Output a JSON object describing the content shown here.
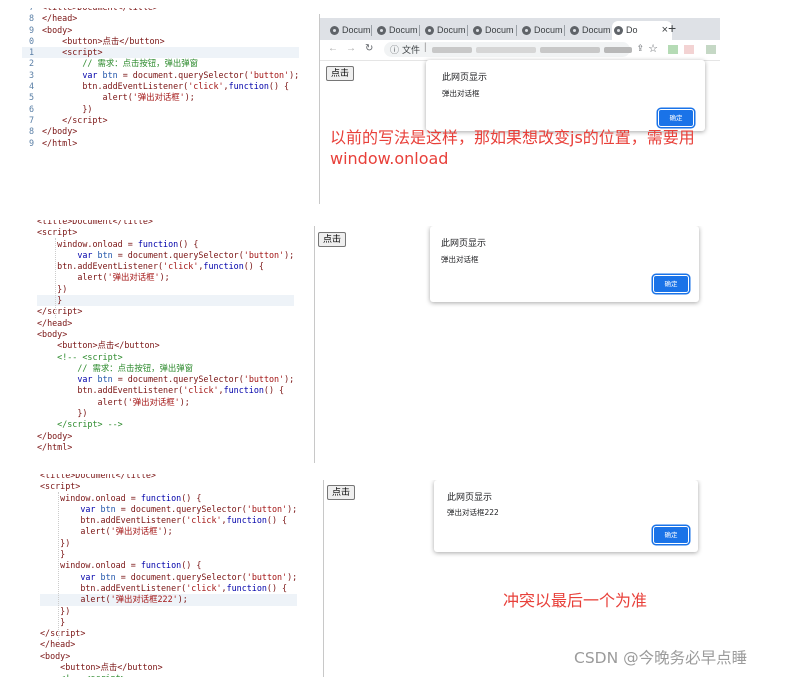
{
  "panel1": {
    "code_lines": [
      {
        "n": "",
        "html": "<span class=\"t\">&lt;title&gt;Document&lt;/title&gt;</span>"
      },
      {
        "n": "",
        "html": "<span class=\"t\">&lt;/head&gt;</span>"
      },
      {
        "n": "",
        "html": "<span class=\"t\">&lt;body&gt;</span>"
      },
      {
        "n": "",
        "html": "    <span class=\"t\">&lt;button&gt;</span>点击<span class=\"t\">&lt;/button&gt;</span>"
      },
      {
        "n": "",
        "html": "    <span class=\"t\">&lt;script&gt;</span>"
      },
      {
        "n": "",
        "html": "        <span class=\"c\">// 需求：点击按钮，弹出弹窗</span>"
      },
      {
        "n": "",
        "html": "        <span class=\"k\">var</span> <span class=\"v\">btn</span> = document.querySelector(<span class=\"s\">'button'</span>);"
      },
      {
        "n": "",
        "html": "        btn.addEventListener(<span class=\"s\">'click'</span>,<span class=\"k\">function</span>() {"
      },
      {
        "n": "",
        "html": "            alert(<span class=\"s\">'弹出对话框'</span>);"
      },
      {
        "n": "",
        "html": "        })"
      },
      {
        "n": "",
        "html": "    <span class=\"t\">&lt;/script&gt;</span>"
      },
      {
        "n": "",
        "html": "<span class=\"t\">&lt;/body&gt;</span>"
      },
      {
        "n": "",
        "html": "<span class=\"t\">&lt;/html&gt;</span>"
      }
    ],
    "line_numbers": [
      "",
      "7",
      "8",
      "9",
      "0",
      "1",
      "2",
      "3",
      "4",
      "5",
      "6",
      "7",
      "8",
      "9"
    ],
    "tabs": [
      "Docum",
      "Docum",
      "Docum",
      "Docum",
      "Docum",
      "Docum",
      "Do"
    ],
    "new_tab": "+",
    "close_tab": "×",
    "address_prefix": "文件",
    "page_button": "点击",
    "dialog_title": "此网页显示",
    "dialog_message": "弹出对话框",
    "ok_label": "确定",
    "annotation": "以前的写法是这样，那如果想改变js的位置，需要用window.onload"
  },
  "panel2": {
    "code_lines": [
      "<span class=\"t\">&lt;title&gt;Document&lt;/title&gt;</span>",
      "<span class=\"t\">&lt;script&gt;</span>",
      "    window.onload = <span class=\"k\">function</span>() {",
      "        <span class=\"k\">var</span> <span class=\"v\">btn</span> = document.querySelector(<span class=\"s\">'button'</span>);",
      "    btn.addEventListener(<span class=\"s\">'click'</span>,<span class=\"k\">function</span>() {",
      "        alert(<span class=\"s\">'弹出对话框'</span>);",
      "    })",
      "    }",
      "<span class=\"t\">&lt;/script&gt;</span>",
      "<span class=\"t\">&lt;/head&gt;</span>",
      "<span class=\"t\">&lt;body&gt;</span>",
      "    <span class=\"t\">&lt;button&gt;</span>点击<span class=\"t\">&lt;/button&gt;</span>",
      "    <span class=\"c\">&lt;!-- &lt;script&gt;</span>",
      "        <span class=\"c\">// 需求：点击按钮，弹出弹窗</span>",
      "        <span class=\"k\">var</span> <span class=\"v\">btn</span> = document.querySelector(<span class=\"s\">'button'</span>);",
      "        btn.addEventListener(<span class=\"s\">'click'</span>,<span class=\"k\">function</span>() {",
      "            alert(<span class=\"s\">'弹出对话框'</span>);",
      "        })",
      "    <span class=\"c\">&lt;/script&gt; --&gt;</span>",
      "<span class=\"t\">&lt;/body&gt;</span>",
      "<span class=\"t\">&lt;/html&gt;</span>"
    ],
    "page_button": "点击",
    "dialog_title": "此网页显示",
    "dialog_message": "弹出对话框",
    "ok_label": "确定"
  },
  "panel3": {
    "code_lines": [
      "<span class=\"t\">&lt;title&gt;Document&lt;/title&gt;</span>",
      "<span class=\"t\">&lt;script&gt;</span>",
      "    window.onload = <span class=\"k\">function</span>() {",
      "        <span class=\"k\">var</span> <span class=\"v\">btn</span> = document.querySelector(<span class=\"s\">'button'</span>);",
      "        btn.addEventListener(<span class=\"s\">'click'</span>,<span class=\"k\">function</span>() {",
      "        alert(<span class=\"s\">'弹出对话框'</span>);",
      "    })",
      "    }",
      "    window.onload = <span class=\"k\">function</span>() {",
      "        <span class=\"k\">var</span> <span class=\"v\">btn</span> = document.querySelector(<span class=\"s\">'button'</span>);",
      "        btn.addEventListener(<span class=\"s\">'click'</span>,<span class=\"k\">function</span>() {",
      "        alert(<span class=\"s\">'弹出对话框222'</span>);",
      "    })",
      "    }",
      "<span class=\"t\">&lt;/script&gt;</span>",
      "<span class=\"t\">&lt;/head&gt;</span>",
      "<span class=\"t\">&lt;body&gt;</span>",
      "    <span class=\"t\">&lt;button&gt;</span>点击<span class=\"t\">&lt;/button&gt;</span>",
      "    <span class=\"c\">&lt;!-- &lt;script&gt;</span>"
    ],
    "page_button": "点击",
    "dialog_title": "此网页显示",
    "dialog_message": "弹出对话框222",
    "ok_label": "确定",
    "annotation": "冲突以最后一个为准"
  },
  "watermark": "CSDN @今晚务必早点睡"
}
